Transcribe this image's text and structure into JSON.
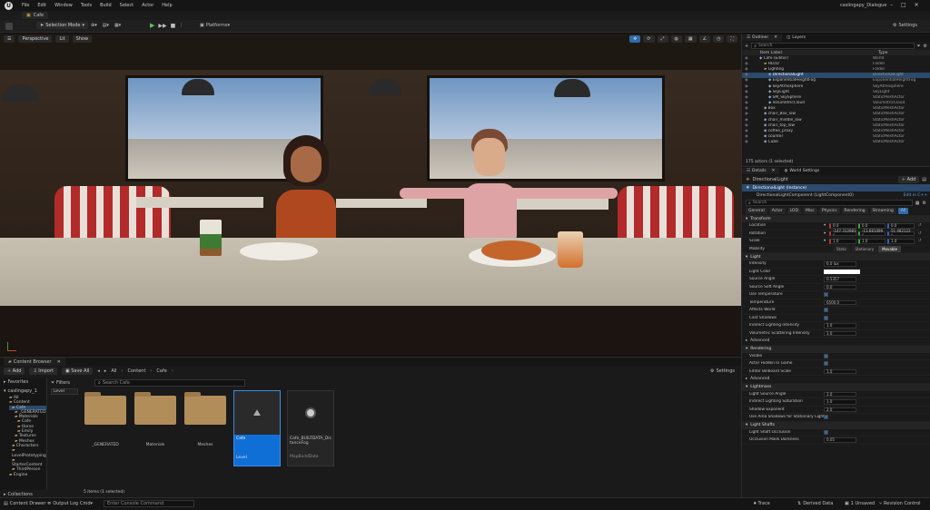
{
  "title_bar": {
    "menus": [
      "File",
      "Edit",
      "Window",
      "Tools",
      "Build",
      "Select",
      "Actor",
      "Help"
    ],
    "project": "caslingapy_Dialogue",
    "level_tab": "Cafe"
  },
  "toolbar": {
    "mode": "Selection Mode",
    "platforms": "Platforms",
    "settings": "Settings"
  },
  "viewport": {
    "perspective": "Perspective",
    "lit": "Lit",
    "show": "Show"
  },
  "content_browser": {
    "tab": "Content Browser",
    "add": "Add",
    "import": "Import",
    "save_all": "Save All",
    "breadcrumb": [
      "All",
      "Content",
      "Cafe"
    ],
    "settings": "Settings",
    "favorites": "Favorites",
    "filters": "Filters",
    "search_placeholder": "Search Cafe",
    "level_filter": "Level",
    "tree_root": "caslingapy_1",
    "tree": [
      "All",
      "Content",
      "Cafe",
      "_GENERATED",
      "Materials",
      "Cafe",
      "Horse",
      "Emily",
      "Textures",
      "Meshes",
      "Characters",
      "LevelPrototyping",
      "StarterContent",
      "ThirdPerson",
      "Engine"
    ],
    "assets": [
      {
        "label": "_GENERATED",
        "kind": "folder"
      },
      {
        "label": "Materials",
        "kind": "folder"
      },
      {
        "label": "Meshes",
        "kind": "folder"
      },
      {
        "label": "Cafe",
        "kind": "level",
        "sub": "Level"
      },
      {
        "label": "Cafe_BUILTDATA_DistanceFog",
        "kind": "data",
        "sub": "MapBuildData"
      }
    ],
    "status": "5 items (1 selected)",
    "collections": "Collections"
  },
  "bottom_bar": {
    "content_drawer": "Content Drawer",
    "output_log": "Output Log",
    "cmd": "Cmd",
    "cmd_placeholder": "Enter Console Command",
    "trace": "Trace",
    "derived_data": "Derived Data",
    "unsaved": "1 Unsaved",
    "revision_control": "Revision Control"
  },
  "outliner": {
    "tab": "Outliner",
    "layers_tab": "Layers",
    "search_placeholder": "Search",
    "col_label": "Item Label",
    "col_type": "Type",
    "rows": [
      {
        "label": "Cafe (Editor)",
        "type": "World",
        "indent": 1
      },
      {
        "label": "HLOD",
        "type": "Folder",
        "indent": 2
      },
      {
        "label": "Lighting",
        "type": "Folder",
        "indent": 2
      },
      {
        "label": "DirectionalLight",
        "type": "DirectionalLight",
        "indent": 3,
        "selected": true
      },
      {
        "label": "ExponentialHeightFog",
        "type": "ExponentialHeightFog",
        "indent": 3
      },
      {
        "label": "SkyAtmosphere",
        "type": "SkyAtmosphere",
        "indent": 3
      },
      {
        "label": "SkyLight",
        "type": "SkyLight",
        "indent": 3
      },
      {
        "label": "SM_SkySphere",
        "type": "StaticMeshActor",
        "indent": 3
      },
      {
        "label": "VolumetricCloud",
        "type": "VolumetricCloud",
        "indent": 3
      },
      {
        "label": "Box",
        "type": "StaticMeshActor",
        "indent": 2
      },
      {
        "label": "chair_Box_low",
        "type": "StaticMeshActor",
        "indent": 2
      },
      {
        "label": "chair_middle_low",
        "type": "StaticMeshActor",
        "indent": 2
      },
      {
        "label": "chair_top_low",
        "type": "StaticMeshActor",
        "indent": 2
      },
      {
        "label": "coffee_proxy",
        "type": "StaticMeshActor",
        "indent": 2
      },
      {
        "label": "counter",
        "type": "StaticMeshActor",
        "indent": 2
      },
      {
        "label": "Cube",
        "type": "StaticMeshActor",
        "indent": 2
      }
    ],
    "status": "175 actors (1 selected)"
  },
  "details": {
    "tab": "Details",
    "world_settings_tab": "World Settings",
    "actor_name": "DirectionalLight",
    "add": "Add",
    "instance": "DirectionalLight (Instance)",
    "component": "DirectionalLightComponent (LightComponent0)",
    "edit_in": "Edit in C++",
    "search_placeholder": "Search",
    "filter_tabs": [
      "General",
      "Actor",
      "LOD",
      "Misc",
      "Physics",
      "Rendering",
      "Streaming",
      "All"
    ],
    "transform": {
      "section": "Transform",
      "location_label": "Location",
      "location": [
        "0.0",
        "0.0",
        "0.0"
      ],
      "rotation_label": "Rotation",
      "rotation": [
        "-147.312983 °",
        "-13.681099 °",
        "51.482122 °"
      ],
      "scale_label": "Scale",
      "scale": [
        "1.0",
        "1.0",
        "1.0"
      ],
      "mobility_label": "Mobility",
      "mobility_options": [
        "Static",
        "Stationary",
        "Movable"
      ]
    },
    "light": {
      "section": "Light",
      "rows": [
        {
          "label": "Intensity",
          "value": "6.0 lux"
        },
        {
          "label": "Light Color",
          "value": ""
        },
        {
          "label": "Source Angle",
          "value": "0.5357"
        },
        {
          "label": "Source Soft Angle",
          "value": "0.0"
        },
        {
          "label": "Use Temperature",
          "value": ""
        },
        {
          "label": "Temperature",
          "value": "6500.0"
        },
        {
          "label": "Affects World",
          "value": ""
        },
        {
          "label": "Cast Shadows",
          "value": ""
        },
        {
          "label": "Indirect Lighting Intensity",
          "value": "1.0"
        },
        {
          "label": "Volumetric Scattering Intensity",
          "value": "1.0"
        }
      ],
      "advanced": "Advanced"
    },
    "rendering": {
      "section": "Rendering",
      "rows": [
        {
          "label": "Visible",
          "value": ""
        },
        {
          "label": "Actor Hidden In Game",
          "value": ""
        },
        {
          "label": "Editor Billboard Scale",
          "value": "1.0"
        }
      ],
      "advanced": "Advanced"
    },
    "lightmass": {
      "section": "Lightmass",
      "rows": [
        {
          "label": "Light Source Angle",
          "value": "1.0"
        },
        {
          "label": "Indirect Lighting Saturation",
          "value": "1.0"
        },
        {
          "label": "Shadow Exponent",
          "value": "2.0"
        },
        {
          "label": "Use Area Shadows for Stationary Light",
          "value": ""
        }
      ]
    },
    "light_shafts": {
      "section": "Light Shafts",
      "rows": [
        {
          "label": "Light Shaft Occlusion",
          "value": ""
        },
        {
          "label": "Occlusion Mask Darkness",
          "value": "0.05"
        }
      ]
    }
  },
  "colors": {
    "accent": "#2d6ca8",
    "selection": "#2c4a6b",
    "panel": "#1a1a1a",
    "folder": "#b18d5a",
    "level_tile": "#0f6fd6"
  }
}
